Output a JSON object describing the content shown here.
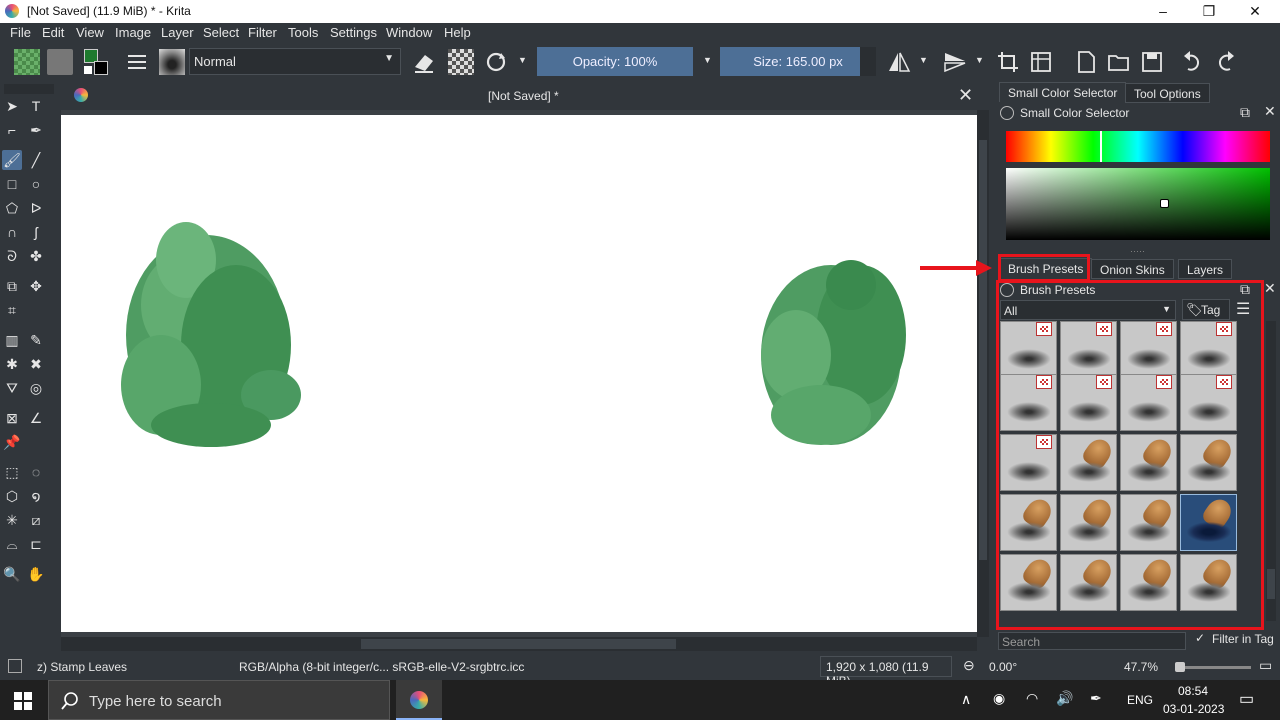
{
  "window": {
    "title": "[Not Saved]  (11.9 MiB)  * - Krita",
    "minimize": "–",
    "restore": "❐",
    "close": "✕"
  },
  "menu": [
    "File",
    "Edit",
    "View",
    "Image",
    "Layer",
    "Select",
    "Filter",
    "Tools",
    "Settings",
    "Window",
    "Help"
  ],
  "toolbar": {
    "blend_mode": "Normal",
    "opacity": "Opacity: 100%",
    "size": "Size: 165.00 px"
  },
  "document": {
    "tab_title": "[Not Saved]  *"
  },
  "right_panel": {
    "top_tabs": [
      "Small Color Selector",
      "Tool Options"
    ],
    "color_selector_title": "Small Color Selector",
    "mid_tabs": [
      "Brush Presets",
      "Onion Skins",
      "Layers"
    ],
    "brush_presets_title": "Brush Presets",
    "filter_value": "All",
    "tag_label": "Tag",
    "search_placeholder": "Search",
    "filter_in_tag": "Filter in Tag"
  },
  "status": {
    "brush": "z) Stamp Leaves",
    "color_space": "RGB/Alpha (8-bit integer/c... sRGB-elle-V2-srgbtrc.icc",
    "dimensions": "1,920 x 1,080 (11.9 MiB)",
    "rotation": "0.00°",
    "zoom": "47.7%"
  },
  "taskbar": {
    "search_placeholder": "Type here to search",
    "lang": "ENG",
    "time": "08:54",
    "date": "03-01-2023"
  },
  "colors": {
    "accent": "#4d6f96",
    "annotation": "#e8141c",
    "foliage": "#3f9a5a"
  }
}
